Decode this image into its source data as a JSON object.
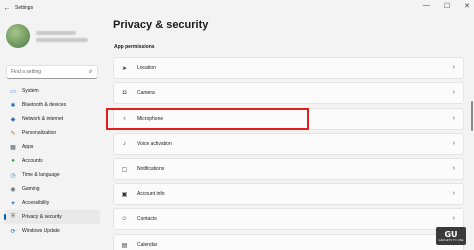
{
  "window": {
    "title": "Settings",
    "back_glyph": "←",
    "controls": [
      "—",
      "☐",
      "✕"
    ]
  },
  "search": {
    "placeholder": "Find a setting",
    "icon": "⌕"
  },
  "nav": [
    {
      "label": "System",
      "icon": "▭",
      "color": "#1f6fc5"
    },
    {
      "label": "Bluetooth & devices",
      "icon": "✱",
      "color": "#1f6fc5"
    },
    {
      "label": "Network & internet",
      "icon": "◆",
      "color": "#3a6fb4"
    },
    {
      "label": "Personalization",
      "icon": "✎",
      "color": "#c46e2a"
    },
    {
      "label": "Apps",
      "icon": "▦",
      "color": "#4a5a6a"
    },
    {
      "label": "Accounts",
      "icon": "●",
      "color": "#2f9e5b"
    },
    {
      "label": "Time & language",
      "icon": "◷",
      "color": "#2b7ec6"
    },
    {
      "label": "Gaming",
      "icon": "◉",
      "color": "#6a6a6a"
    },
    {
      "label": "Accessibility",
      "icon": "✦",
      "color": "#2b6cc1"
    },
    {
      "label": "Privacy & security",
      "icon": "⛨",
      "color": "#6b6b6b",
      "active": true
    },
    {
      "label": "Windows Update",
      "icon": "⟳",
      "color": "#1f6fc5"
    }
  ],
  "main": {
    "title": "Privacy & security",
    "section": "App permissions",
    "items": [
      {
        "label": "Location",
        "icon": "➤"
      },
      {
        "label": "Camera",
        "icon": "◘"
      },
      {
        "label": "Microphone",
        "icon": "♁"
      },
      {
        "label": "Voice activation",
        "icon": "♪"
      },
      {
        "label": "Notifications",
        "icon": "▢"
      },
      {
        "label": "Account info",
        "icon": "▣"
      },
      {
        "label": "Contacts",
        "icon": "☺"
      },
      {
        "label": "Calendar",
        "icon": "▤"
      }
    ],
    "chevron": "›"
  },
  "logo": {
    "text": "GU",
    "tagline": "GADGETS TO USE"
  },
  "colors": {
    "accent": "#005fb8",
    "highlight": "#e0201c"
  }
}
